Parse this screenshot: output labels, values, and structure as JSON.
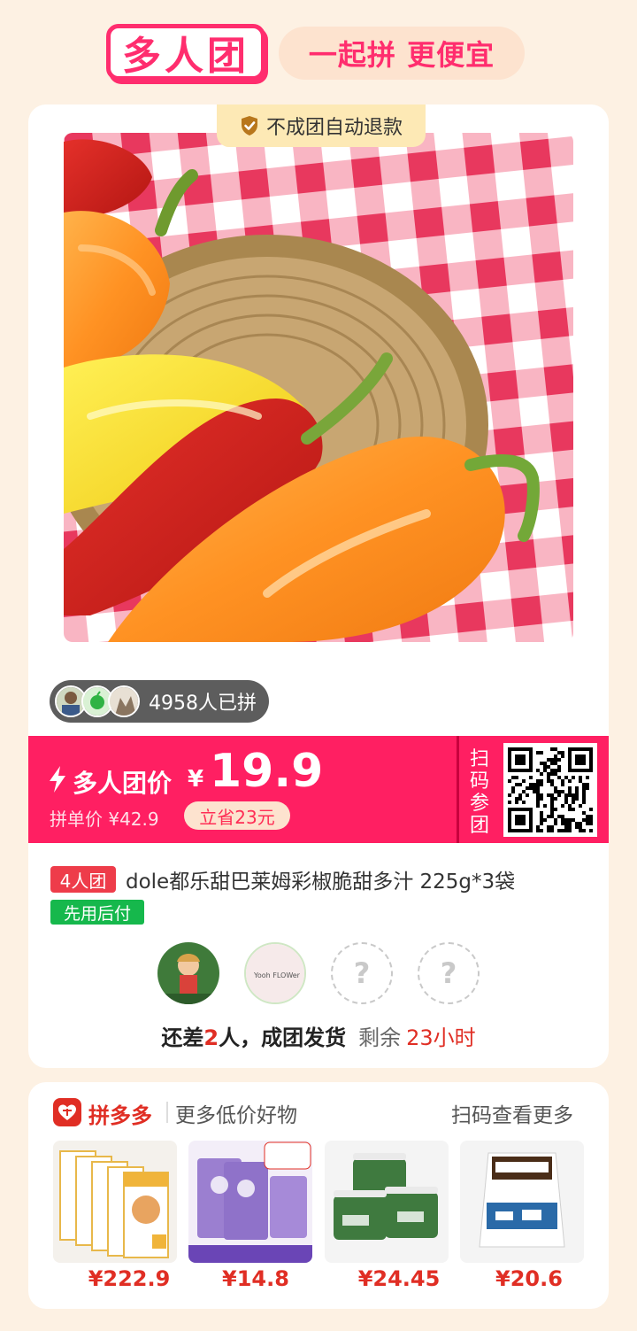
{
  "header": {
    "brand": "多人团",
    "slogan": "一起拼 更便宜"
  },
  "product": {
    "refund_tag": "不成团自动退款",
    "joined_count": "4958人已拼",
    "price_label": "多人团价",
    "currency": "¥",
    "price": "19.9",
    "single_price": "拼单价 ¥42.9",
    "save": "立省23元",
    "scan_join": "扫码参团",
    "group_size": "4人团",
    "title": "dole都乐甜巴莱姆彩椒脆甜多汁 225g*3袋",
    "pay_later": "先用后付",
    "member2_text": "Yooh FLOWer",
    "missing_mark": "?",
    "status_prefix": "还差",
    "status_count": "2",
    "status_suffix": "人，成团发货",
    "remaining_label": "剩余",
    "remaining_time": "23小时"
  },
  "recommend": {
    "brand": "拼多多",
    "subtitle": "更多低价好物",
    "scan_more": "扫码查看更多",
    "items": [
      {
        "price": "¥222.9"
      },
      {
        "price": "¥14.8"
      },
      {
        "price": "¥24.45"
      },
      {
        "price": "¥20.6"
      }
    ]
  }
}
